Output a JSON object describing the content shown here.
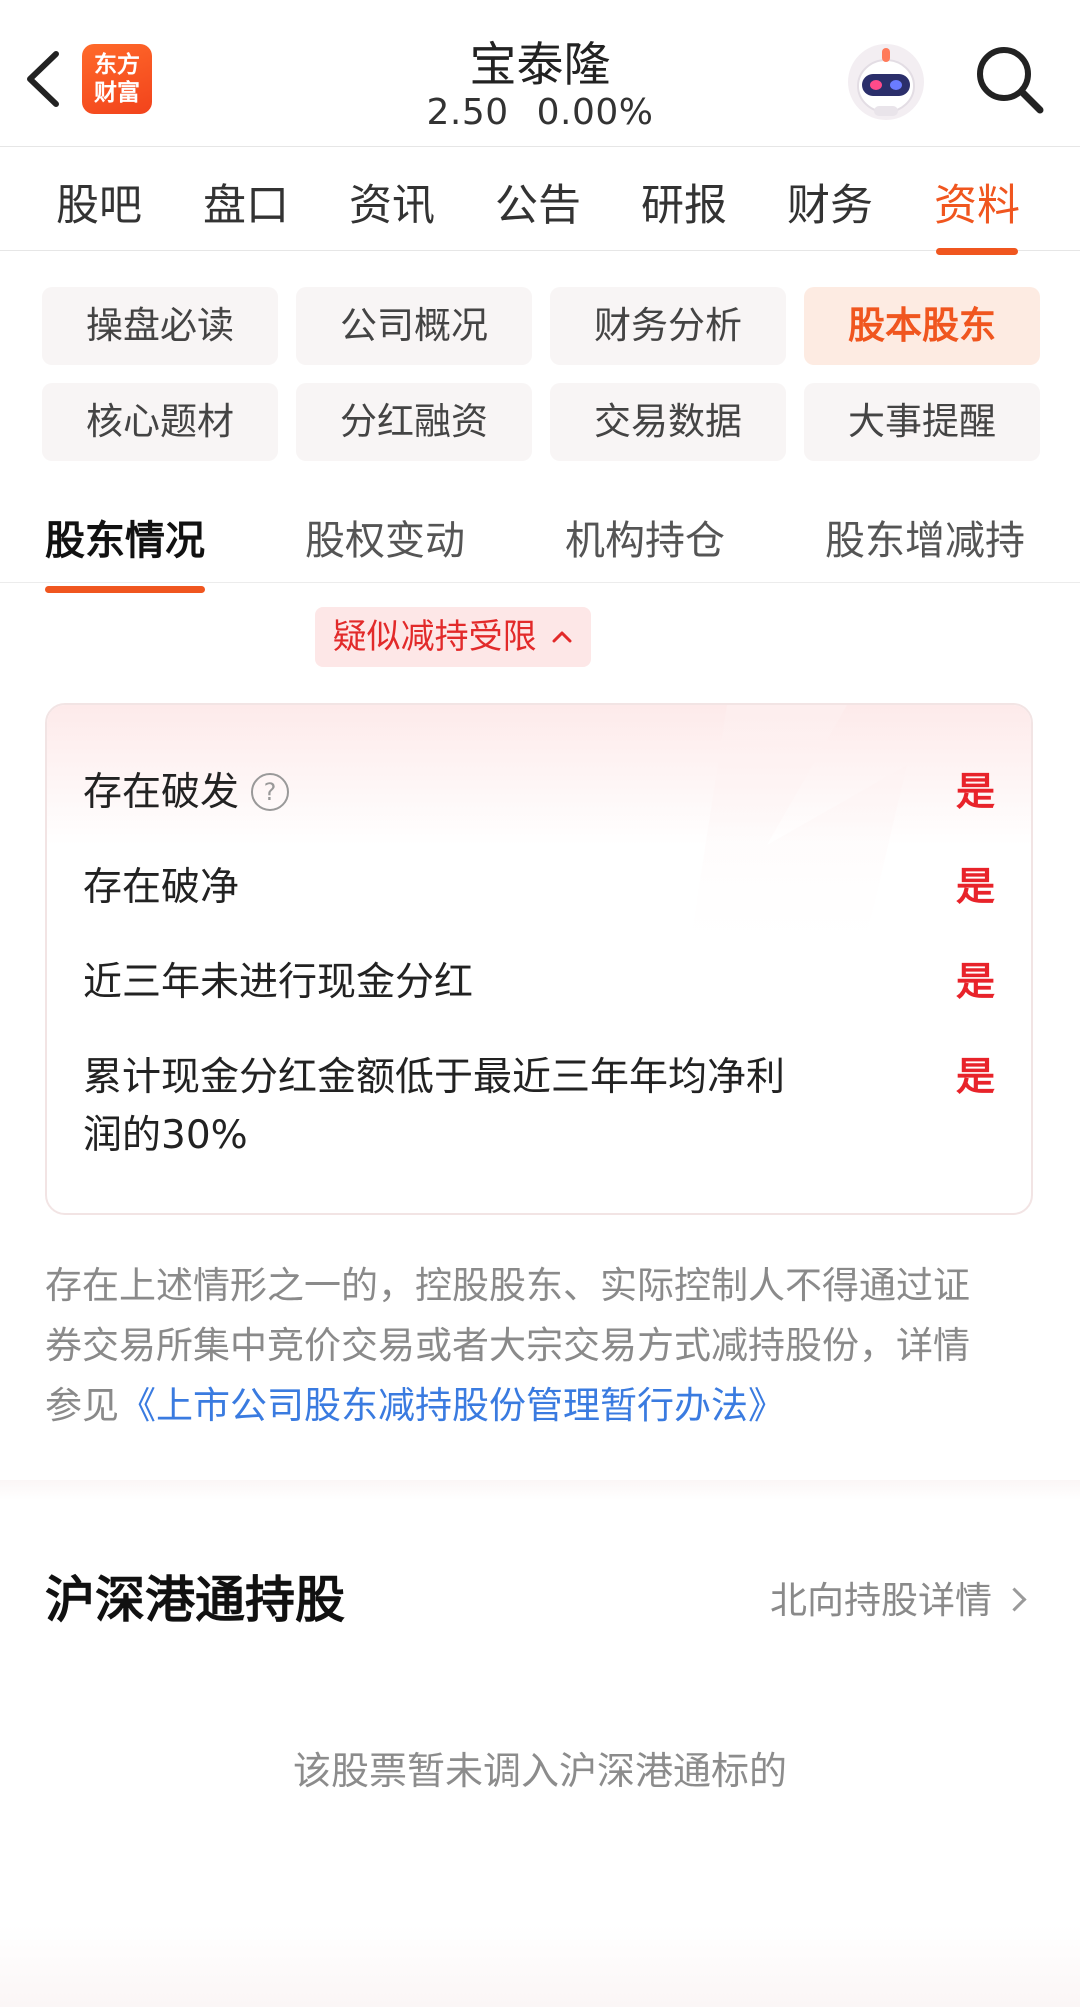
{
  "header": {
    "logo_line1": "东方",
    "logo_line2": "财富",
    "stock_name": "宝泰隆",
    "price": "2.50",
    "change": "0.00%"
  },
  "main_tabs": [
    {
      "label": "股吧"
    },
    {
      "label": "盘口"
    },
    {
      "label": "资讯"
    },
    {
      "label": "公告"
    },
    {
      "label": "研报"
    },
    {
      "label": "财务"
    },
    {
      "label": "资料",
      "active": true
    }
  ],
  "categories": [
    {
      "label": "操盘必读"
    },
    {
      "label": "公司概况"
    },
    {
      "label": "财务分析"
    },
    {
      "label": "股本股东",
      "active": true
    },
    {
      "label": "核心题材"
    },
    {
      "label": "分红融资"
    },
    {
      "label": "交易数据"
    },
    {
      "label": "大事提醒"
    }
  ],
  "sub_tabs": [
    {
      "label": "股东情况",
      "active": true
    },
    {
      "label": "股权变动"
    },
    {
      "label": "机构持仓"
    },
    {
      "label": "股东增减持"
    }
  ],
  "restriction": {
    "pill_label": "疑似减持受限",
    "rows": [
      {
        "label": "存在破发",
        "value": "是",
        "help": true
      },
      {
        "label": "存在破净",
        "value": "是"
      },
      {
        "label": "近三年未进行现金分红",
        "value": "是"
      },
      {
        "label_line1": "累计现金分红金额低于最近三年年均净利",
        "label_line2": "润的30%",
        "value": "是"
      }
    ],
    "note_line1": "存在上述情形之一的，控股股东、实际控制人不得通过证",
    "note_line2": "券交易所集中竞价交易或者大宗交易方式减持股份，详情",
    "note_line3_prefix": "参见",
    "note_link": "《上市公司股东减持股份管理暂行办法》"
  },
  "hk_connect": {
    "title": "沪深港通持股",
    "link_label": "北向持股详情",
    "empty_text": "该股票暂未调入沪深港通标的"
  },
  "colors": {
    "accent": "#f0561f",
    "alert_red": "#e8232a",
    "link_blue": "#3a7be0"
  }
}
